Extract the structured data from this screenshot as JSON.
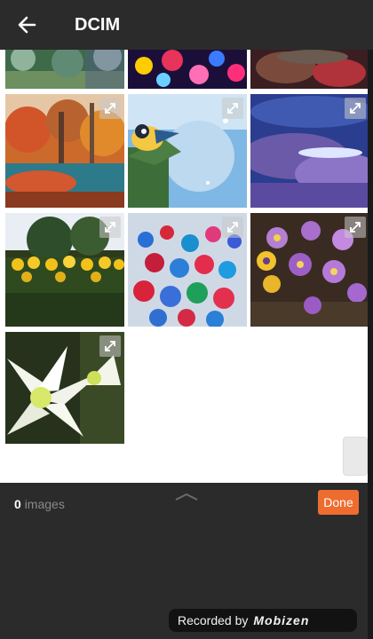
{
  "header": {
    "title": "DCIM"
  },
  "gallery": {
    "thumbnails": [
      {
        "name": "photo-forest-partial"
      },
      {
        "name": "photo-bokeh-partial"
      },
      {
        "name": "photo-blur-partial"
      },
      {
        "name": "photo-autumn-lake"
      },
      {
        "name": "photo-bird-snow"
      },
      {
        "name": "photo-purple-sky"
      },
      {
        "name": "photo-sunflowers"
      },
      {
        "name": "photo-color-spheres"
      },
      {
        "name": "photo-violas"
      },
      {
        "name": "photo-white-lily"
      }
    ]
  },
  "footer": {
    "count_number": "0",
    "count_label": "images",
    "done_label": "Done"
  },
  "overlay": {
    "recorded_label": "Recorded by",
    "brand": "Mobizen"
  },
  "colors": {
    "bar": "#2b2b2b",
    "accent": "#ef6c2f"
  }
}
